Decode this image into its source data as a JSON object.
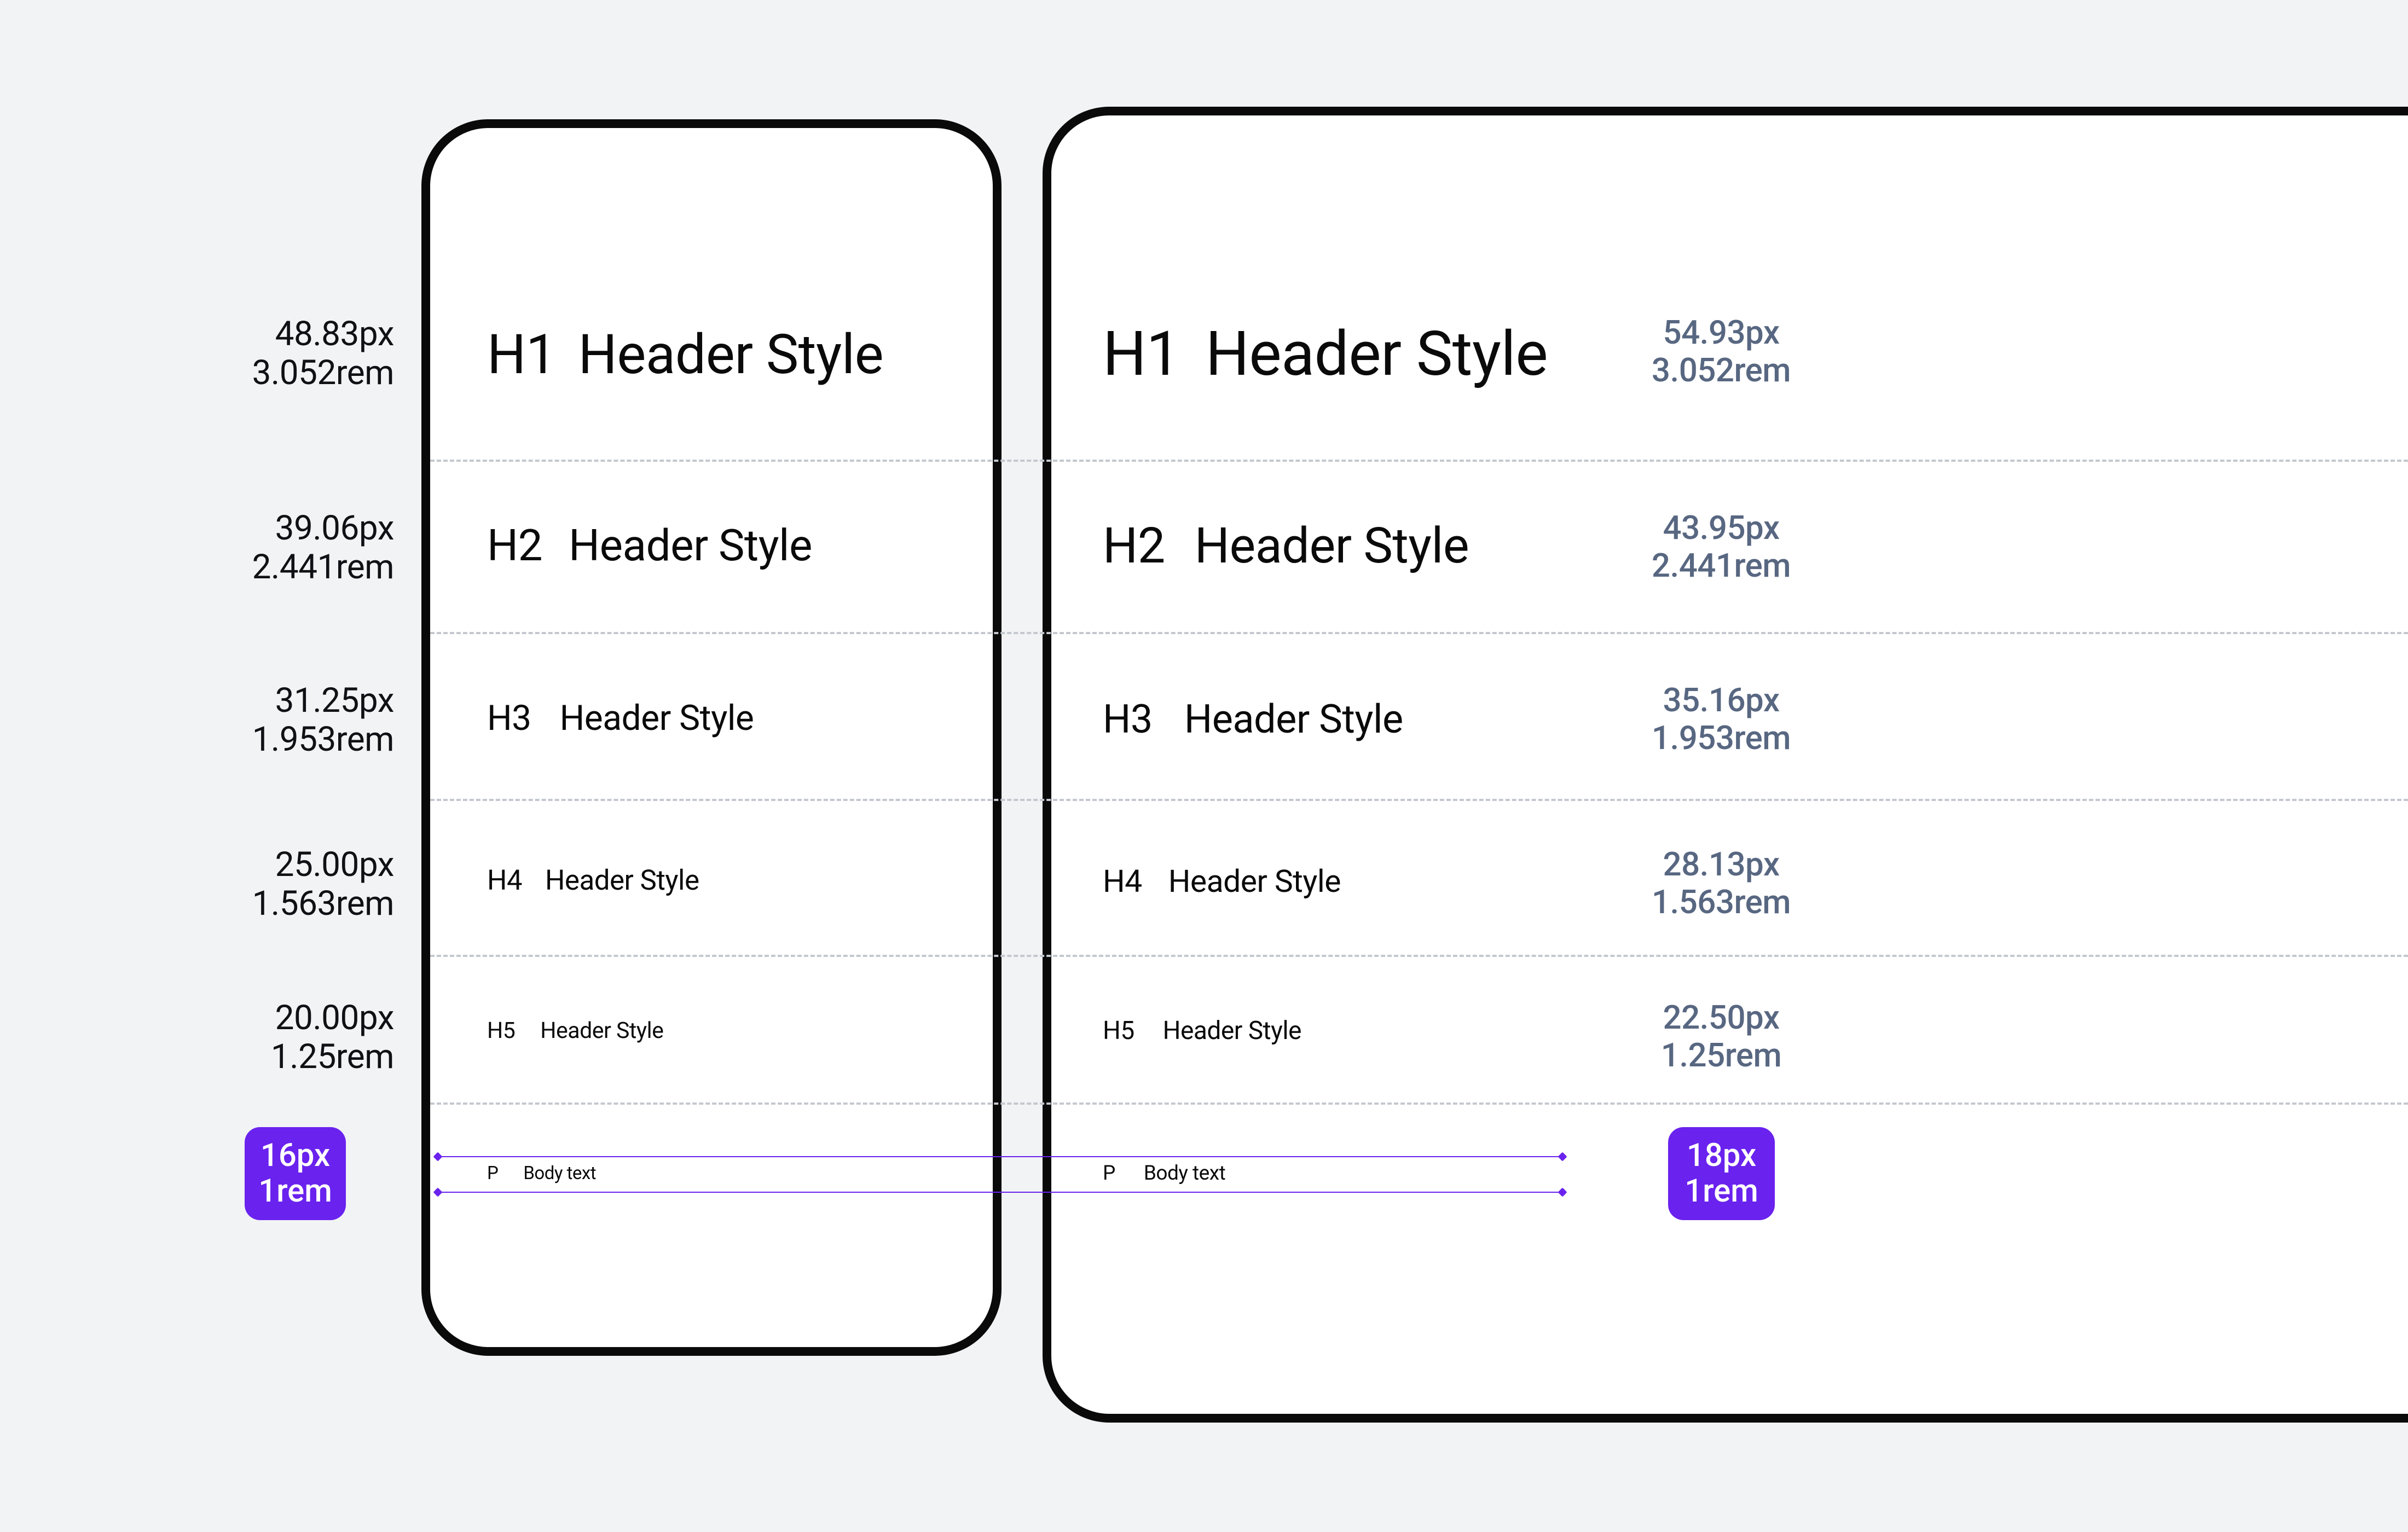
{
  "base_mobile": {
    "px": "16px",
    "rem": "1rem"
  },
  "base_tablet": {
    "px": "18px",
    "rem": "1rem"
  },
  "row": {
    "h1": {
      "tag": "H1",
      "label": "Header Style",
      "mobile": {
        "px": "48.83px",
        "rem": "3.052rem"
      },
      "tablet": {
        "px": "54.93px",
        "rem": "3.052rem"
      }
    },
    "h2": {
      "tag": "H2",
      "label": "Header Style",
      "mobile": {
        "px": "39.06px",
        "rem": "2.441rem"
      },
      "tablet": {
        "px": "43.95px",
        "rem": "2.441rem"
      }
    },
    "h3": {
      "tag": "H3",
      "label": "Header Style",
      "mobile": {
        "px": "31.25px",
        "rem": "1.953rem"
      },
      "tablet": {
        "px": "35.16px",
        "rem": "1.953rem"
      }
    },
    "h4": {
      "tag": "H4",
      "label": "Header Style",
      "mobile": {
        "px": "25.00px",
        "rem": "1.563rem"
      },
      "tablet": {
        "px": "28.13px",
        "rem": "1.563rem"
      }
    },
    "h5": {
      "tag": "H5",
      "label": "Header Style",
      "mobile": {
        "px": "20.00px",
        "rem": "1.25rem"
      },
      "tablet": {
        "px": "22.50px",
        "rem": "1.25rem"
      }
    },
    "p": {
      "tag": "P",
      "label": "Body text"
    }
  }
}
